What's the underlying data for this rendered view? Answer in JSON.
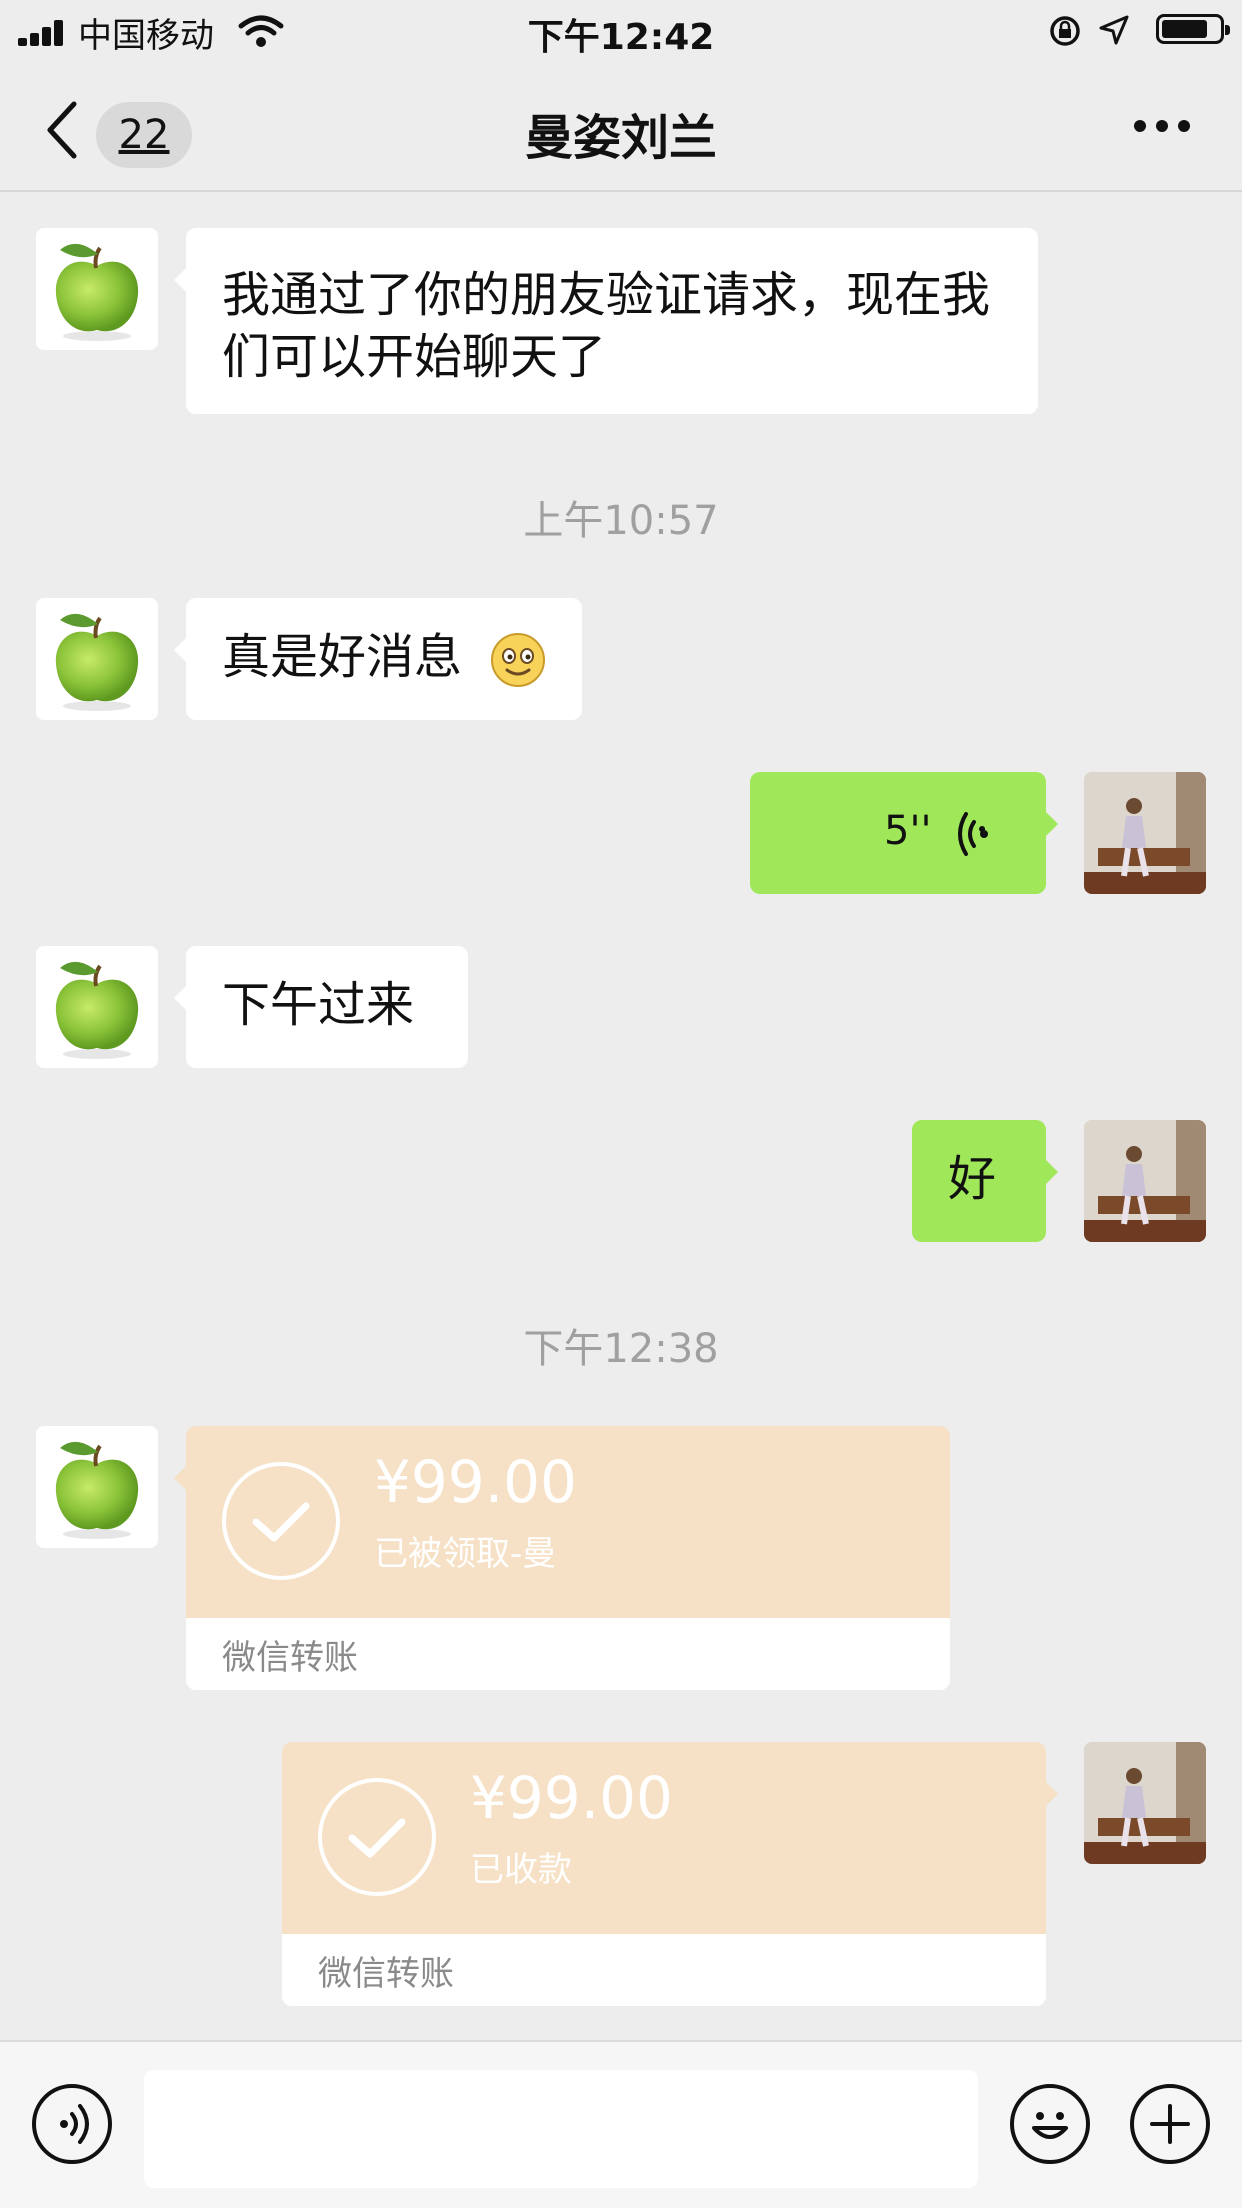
{
  "status_bar": {
    "carrier": "中国移动",
    "time": "下午12:42"
  },
  "nav": {
    "unread_count": "22",
    "title": "曼姿刘兰",
    "more_icon": "more-dots-icon",
    "back_icon": "chevron-left-icon"
  },
  "messages": [
    {
      "side": "left",
      "type": "text",
      "text": "我通过了你的朋友验证请求，现在我们可以开始聊天了"
    },
    {
      "type": "timestamp",
      "text": "上午10:57"
    },
    {
      "side": "left",
      "type": "text",
      "text": "真是好消息",
      "emoji": "smile-emoji"
    },
    {
      "side": "right",
      "type": "voice",
      "duration": "5''"
    },
    {
      "side": "left",
      "type": "text",
      "text": "下午过来"
    },
    {
      "side": "right",
      "type": "text",
      "text": "好"
    },
    {
      "type": "timestamp",
      "text": "下午12:38"
    },
    {
      "side": "left",
      "type": "transfer",
      "amount": "¥99.00",
      "status": "已被领取-曼",
      "label": "微信转账"
    },
    {
      "side": "right",
      "type": "transfer",
      "amount": "¥99.00",
      "status": "已收款",
      "label": "微信转账"
    }
  ],
  "input_bar": {
    "voice_icon": "voice-input-icon",
    "emoji_icon": "emoji-icon",
    "plus_icon": "plus-icon",
    "placeholder": ""
  },
  "colors": {
    "background": "#ededed",
    "sent_bubble": "#a0e75a",
    "received_bubble": "#ffffff",
    "transfer_card": "#f6e1c6"
  }
}
